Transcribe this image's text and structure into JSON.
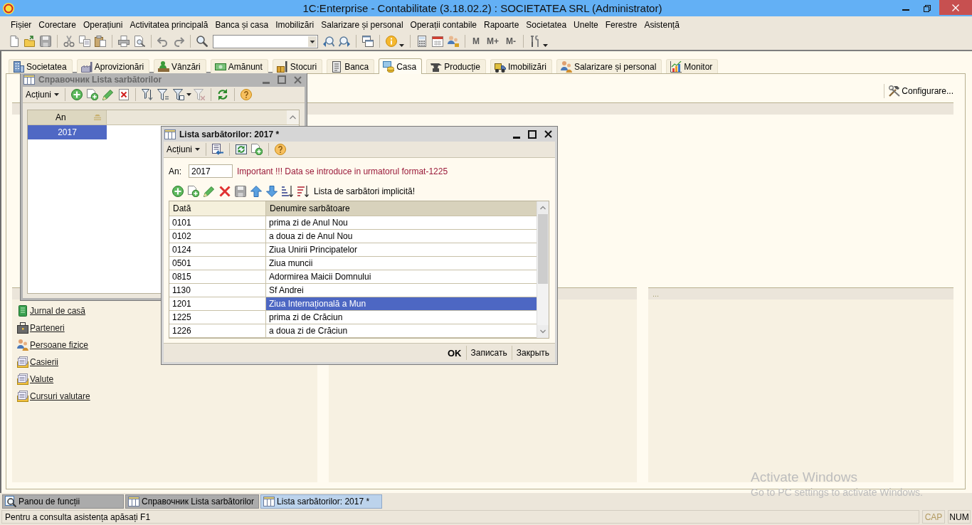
{
  "window": {
    "title": "1C:Enterprise - Contabilitate (3.18.02.2) : SOCIETATEA SRL (Administrator)"
  },
  "menu": [
    "Fișier",
    "Corectare",
    "Operațiuni",
    "Activitatea principală",
    "Banca și casa",
    "Imobilizări",
    "Salarizare și personal",
    "Operații contabile",
    "Rapoarte",
    "Societatea",
    "Unelte",
    "Ferestre",
    "Asistență"
  ],
  "toolbar": {
    "memory_buttons": [
      "M",
      "M+",
      "M-"
    ]
  },
  "tabs": [
    {
      "label": "Societatea",
      "selected": false
    },
    {
      "label": "Aprovizionări",
      "selected": false
    },
    {
      "label": "Vânzări",
      "selected": false
    },
    {
      "label": "Amănunt",
      "selected": false
    },
    {
      "label": "Stocuri",
      "selected": false
    },
    {
      "label": "Banca",
      "selected": false
    },
    {
      "label": "Casa",
      "selected": true
    },
    {
      "label": "Producție",
      "selected": false
    },
    {
      "label": "Imobilizări",
      "selected": false
    },
    {
      "label": "Salarizare și personal",
      "selected": false
    },
    {
      "label": "Monitor",
      "selected": false
    }
  ],
  "function_panel": {
    "configure_button": "Configurare...",
    "links": [
      "Jurnal de casă",
      "Parteneri",
      "Persoane fizice",
      "Casierii",
      "Valute",
      "Cursuri valutare"
    ],
    "right_panel_header": "..."
  },
  "windows": [
    {
      "kind": "list",
      "title": "Справочник Lista sarbătorilor",
      "active": false,
      "actions_menu": "Acțiuni",
      "table": {
        "columns": [
          "An"
        ],
        "rows": [
          {
            "cells": [
              "2017"
            ],
            "selected": true
          }
        ]
      }
    },
    {
      "kind": "form",
      "title": "Lista sarbătorilor: 2017 *",
      "active": true,
      "actions_menu": "Acțiuni",
      "year_label": "An:",
      "year_value": "2017",
      "notice": "Important !!! Data se introduce in urmatorul format-1225",
      "default_list_button": "Lista de sarbători implicită!",
      "table": {
        "columns": [
          "Dată",
          "Denumire sarbătoare"
        ],
        "rows": [
          {
            "cells": [
              "0101",
              "prima zi de Anul Nou"
            ],
            "selected": false
          },
          {
            "cells": [
              "0102",
              "a doua zi de Anul Nou"
            ],
            "selected": false
          },
          {
            "cells": [
              "0124",
              "Ziua Unirii Principatelor"
            ],
            "selected": false
          },
          {
            "cells": [
              "0501",
              "Ziua muncii"
            ],
            "selected": false
          },
          {
            "cells": [
              "0815",
              "Adormirea Maicii Domnului"
            ],
            "selected": false
          },
          {
            "cells": [
              "1130",
              "Sf Andrei"
            ],
            "selected": false
          },
          {
            "cells": [
              "1201",
              "Ziua Internațională a Mun"
            ],
            "selected": true
          },
          {
            "cells": [
              "1225",
              "prima zi de Crăciun"
            ],
            "selected": false
          },
          {
            "cells": [
              "1226",
              "a doua zi de Crăciun"
            ],
            "selected": false
          }
        ]
      },
      "buttons": [
        {
          "label": "OK",
          "default": true
        },
        {
          "label": "Записать",
          "default": false
        },
        {
          "label": "Закрыть",
          "default": false
        }
      ]
    }
  ],
  "taskbar": [
    {
      "label": "Panou de funcții",
      "selected": false
    },
    {
      "label": "Справочник Lista sarbătorilor",
      "selected": false
    },
    {
      "label": "Lista sarbătorilor: 2017 *",
      "selected": true
    }
  ],
  "status_bar": {
    "hint": "Pentru a consulta asistența apăsați F1",
    "indicators": [
      {
        "label": "CAP",
        "on": false
      },
      {
        "label": "NUM",
        "on": true
      }
    ]
  },
  "os_notice": {
    "title": "Activate Windows",
    "text": "Go to PC settings to activate Windows."
  }
}
